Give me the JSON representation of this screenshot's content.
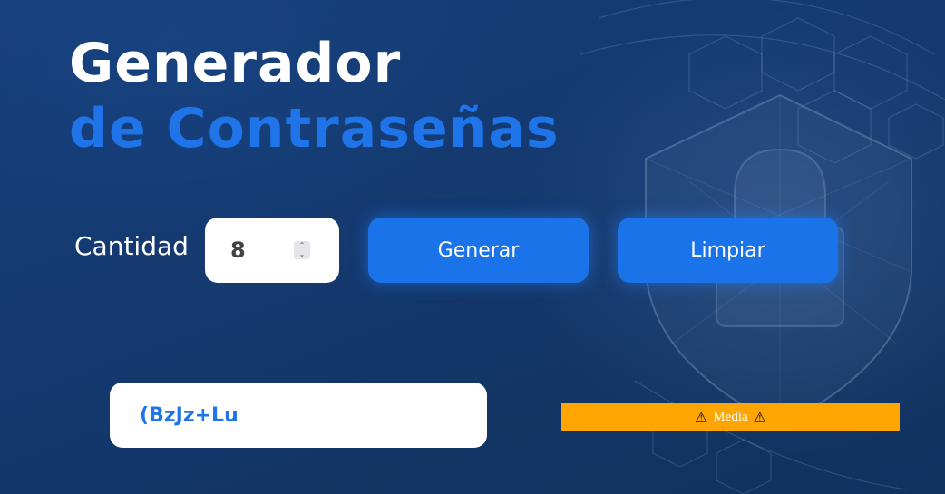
{
  "title": {
    "line1": "Generador",
    "line2": "de Contraseñas"
  },
  "quantity": {
    "label": "Cantidad",
    "value": "8"
  },
  "buttons": {
    "generate": "Generar",
    "clear": "Limpiar"
  },
  "output": {
    "password": "(BzJz+Lu"
  },
  "strength": {
    "label": "Media",
    "icon": "warning-icon",
    "glyph": "⚠",
    "color": "#ffa500"
  },
  "colors": {
    "accent": "#1a73e8",
    "title_highlight": "#1e74e8"
  }
}
